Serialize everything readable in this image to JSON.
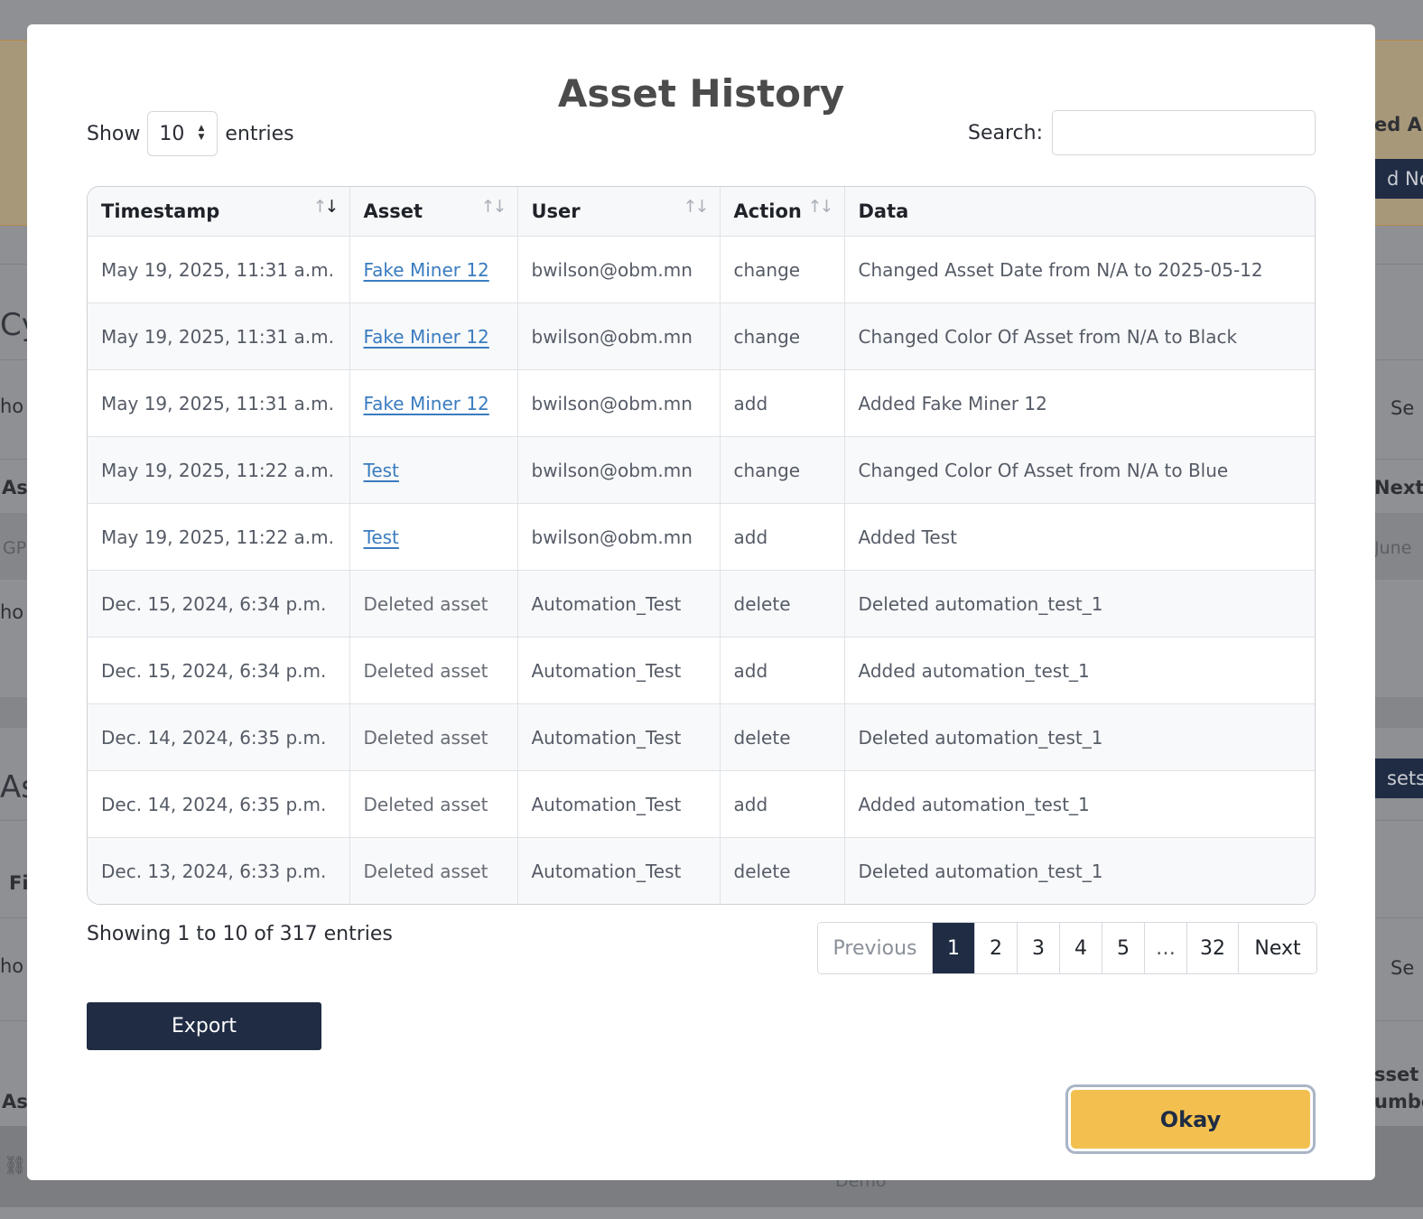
{
  "background": {
    "fragments": [
      "ed As",
      "d No",
      "Cy",
      "ho",
      "Se",
      "As",
      "Next",
      "GP",
      "June",
      "ho",
      "As",
      "sets",
      "Fi",
      "ho",
      "Se",
      "As",
      "sset",
      "umbe",
      "Demo"
    ]
  },
  "modal": {
    "title": "Asset History",
    "length_prefix": "Show",
    "length_value": "10",
    "length_suffix": "entries",
    "search_label": "Search:",
    "search_value": "",
    "columns": [
      "Timestamp",
      "Asset",
      "User",
      "Action",
      "Data"
    ],
    "rows": [
      {
        "timestamp": "May 19, 2025, 11:31 a.m.",
        "asset": "Fake Miner 12",
        "asset_link": true,
        "user": "bwilson@obm.mn",
        "action": "change",
        "data": "Changed Asset Date from N/A to 2025-05-12"
      },
      {
        "timestamp": "May 19, 2025, 11:31 a.m.",
        "asset": "Fake Miner 12",
        "asset_link": true,
        "user": "bwilson@obm.mn",
        "action": "change",
        "data": "Changed Color Of Asset from N/A to Black"
      },
      {
        "timestamp": "May 19, 2025, 11:31 a.m.",
        "asset": "Fake Miner 12",
        "asset_link": true,
        "user": "bwilson@obm.mn",
        "action": "add",
        "data": "Added Fake Miner 12"
      },
      {
        "timestamp": "May 19, 2025, 11:22 a.m.",
        "asset": "Test",
        "asset_link": true,
        "user": "bwilson@obm.mn",
        "action": "change",
        "data": "Changed Color Of Asset from N/A to Blue"
      },
      {
        "timestamp": "May 19, 2025, 11:22 a.m.",
        "asset": "Test",
        "asset_link": true,
        "user": "bwilson@obm.mn",
        "action": "add",
        "data": "Added Test"
      },
      {
        "timestamp": "Dec. 15, 2024, 6:34 p.m.",
        "asset": "Deleted asset",
        "asset_link": false,
        "user": "Automation_Test",
        "action": "delete",
        "data": "Deleted automation_test_1"
      },
      {
        "timestamp": "Dec. 15, 2024, 6:34 p.m.",
        "asset": "Deleted asset",
        "asset_link": false,
        "user": "Automation_Test",
        "action": "add",
        "data": "Added automation_test_1"
      },
      {
        "timestamp": "Dec. 14, 2024, 6:35 p.m.",
        "asset": "Deleted asset",
        "asset_link": false,
        "user": "Automation_Test",
        "action": "delete",
        "data": "Deleted automation_test_1"
      },
      {
        "timestamp": "Dec. 14, 2024, 6:35 p.m.",
        "asset": "Deleted asset",
        "asset_link": false,
        "user": "Automation_Test",
        "action": "add",
        "data": "Added automation_test_1"
      },
      {
        "timestamp": "Dec. 13, 2024, 6:33 p.m.",
        "asset": "Deleted asset",
        "asset_link": false,
        "user": "Automation_Test",
        "action": "delete",
        "data": "Deleted automation_test_1"
      }
    ],
    "info": "Showing 1 to 10 of 317 entries",
    "pagination": {
      "previous": "Previous",
      "pages": [
        "1",
        "2",
        "3",
        "4",
        "5",
        "…",
        "32"
      ],
      "current": "1",
      "next": "Next"
    },
    "export_label": "Export",
    "okay_label": "Okay"
  },
  "colors": {
    "primary": "#1f2c44",
    "accent": "#f3c04f",
    "link": "#3a7cc0"
  },
  "icons": {
    "sort_active": "sort-desc-icon",
    "sort_idle": "sort-both-icon",
    "select_arrows": "updown-arrow-icon"
  }
}
